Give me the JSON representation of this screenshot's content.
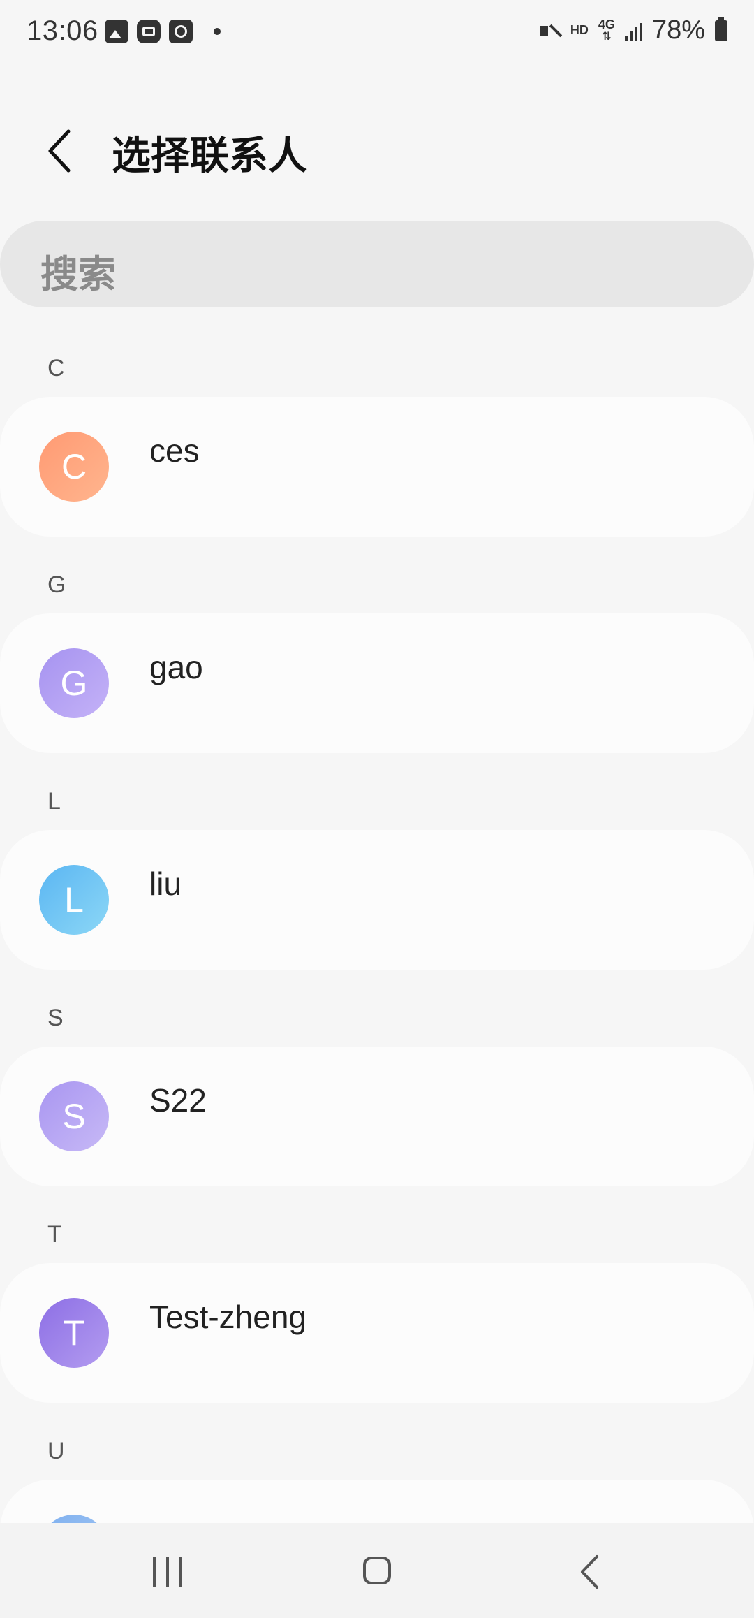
{
  "status_bar": {
    "time": "13:06",
    "hd": "HD",
    "network": "4G",
    "battery": "78%"
  },
  "header": {
    "title": "选择联系人"
  },
  "search": {
    "placeholder": "搜索"
  },
  "sections": [
    {
      "letter": "C",
      "contact": {
        "initial": "C",
        "name": "ces",
        "color_from": "#ff9a73",
        "color_to": "#ffb58e"
      }
    },
    {
      "letter": "G",
      "contact": {
        "initial": "G",
        "name": "gao",
        "color_from": "#a693f0",
        "color_to": "#c4b2f7"
      }
    },
    {
      "letter": "L",
      "contact": {
        "initial": "L",
        "name": "liu",
        "color_from": "#5bb6f2",
        "color_to": "#8cd7f6"
      }
    },
    {
      "letter": "S",
      "contact": {
        "initial": "S",
        "name": "S22",
        "color_from": "#a996f1",
        "color_to": "#c7b9f6"
      }
    },
    {
      "letter": "T",
      "contact": {
        "initial": "T",
        "name": "Test-zheng",
        "color_from": "#8d6fe5",
        "color_to": "#b39cf0"
      }
    },
    {
      "letter": "U",
      "contact": {
        "initial": "",
        "name": "",
        "color_from": "#7fb0ef",
        "color_to": "#a5c8f4"
      }
    }
  ]
}
